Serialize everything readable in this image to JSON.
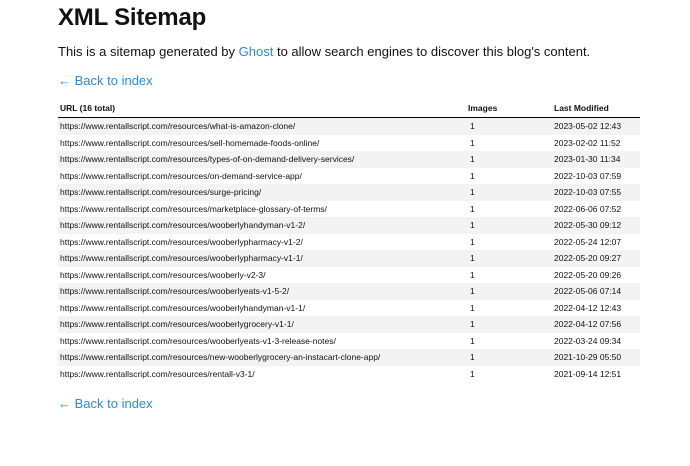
{
  "header": {
    "title": "XML Sitemap"
  },
  "description": {
    "before": "This is a sitemap generated by ",
    "link": "Ghost",
    "after": " to allow search engines to discover this blog's content."
  },
  "nav": {
    "back_label": "← Back to index"
  },
  "table": {
    "headers": {
      "url": "URL (16 total)",
      "images": "Images",
      "modified": "Last Modified"
    },
    "rows": [
      {
        "url": "https://www.rentallscript.com/resources/what-is-amazon-clone/",
        "images": "1",
        "modified": "2023-05-02 12:43"
      },
      {
        "url": "https://www.rentallscript.com/resources/sell-homemade-foods-online/",
        "images": "1",
        "modified": "2023-02-02 11:52"
      },
      {
        "url": "https://www.rentallscript.com/resources/types-of-on-demand-delivery-services/",
        "images": "1",
        "modified": "2023-01-30 11:34"
      },
      {
        "url": "https://www.rentallscript.com/resources/on-demand-service-app/",
        "images": "1",
        "modified": "2022-10-03 07:59"
      },
      {
        "url": "https://www.rentallscript.com/resources/surge-pricing/",
        "images": "1",
        "modified": "2022-10-03 07:55"
      },
      {
        "url": "https://www.rentallscript.com/resources/marketplace-glossary-of-terms/",
        "images": "1",
        "modified": "2022-06-06 07:52"
      },
      {
        "url": "https://www.rentallscript.com/resources/wooberlyhandyman-v1-2/",
        "images": "1",
        "modified": "2022-05-30 09:12"
      },
      {
        "url": "https://www.rentallscript.com/resources/wooberlypharmacy-v1-2/",
        "images": "1",
        "modified": "2022-05-24 12:07"
      },
      {
        "url": "https://www.rentallscript.com/resources/wooberlypharmacy-v1-1/",
        "images": "1",
        "modified": "2022-05-20 09:27"
      },
      {
        "url": "https://www.rentallscript.com/resources/wooberly-v2-3/",
        "images": "1",
        "modified": "2022-05-20 09:26"
      },
      {
        "url": "https://www.rentallscript.com/resources/wooberlyeats-v1-5-2/",
        "images": "1",
        "modified": "2022-05-06 07:14"
      },
      {
        "url": "https://www.rentallscript.com/resources/wooberlyhandyman-v1-1/",
        "images": "1",
        "modified": "2022-04-12 12:43"
      },
      {
        "url": "https://www.rentallscript.com/resources/wooberlygrocery-v1-1/",
        "images": "1",
        "modified": "2022-04-12 07:56"
      },
      {
        "url": "https://www.rentallscript.com/resources/wooberlyeats-v1-3-release-notes/",
        "images": "1",
        "modified": "2022-03-24 09:34"
      },
      {
        "url": "https://www.rentallscript.com/resources/new-wooberlygrocery-an-instacart-clone-app/",
        "images": "1",
        "modified": "2021-10-29 05:50"
      },
      {
        "url": "https://www.rentallscript.com/resources/rentall-v3-1/",
        "images": "1",
        "modified": "2021-09-14 12:51"
      }
    ]
  },
  "colors": {
    "link": "#2b8ad8",
    "row_stripe": "#f3f3f3"
  }
}
